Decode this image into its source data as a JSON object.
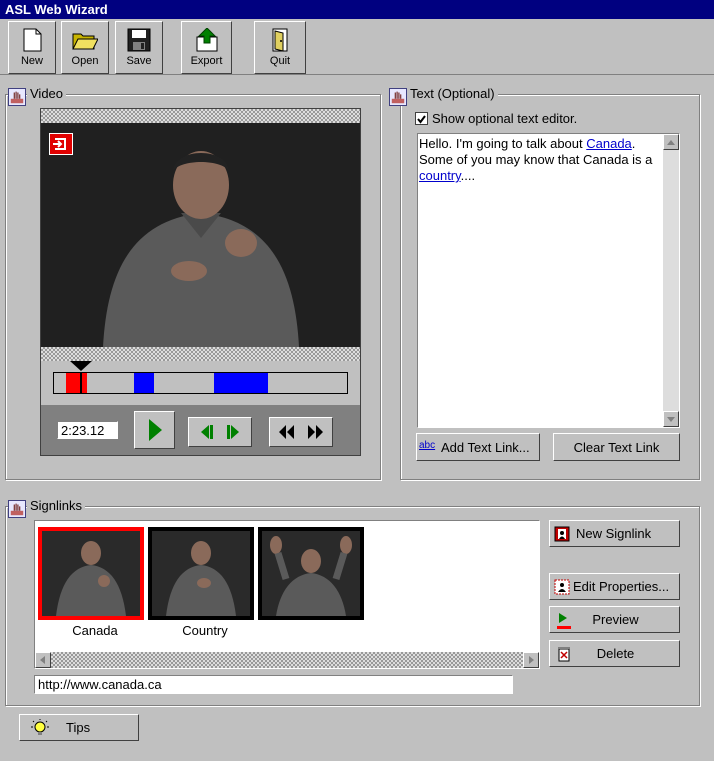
{
  "window": {
    "title": "ASL Web Wizard"
  },
  "toolbar": {
    "new_label": "New",
    "open_label": "Open",
    "save_label": "Save",
    "export_label": "Export",
    "quit_label": "Quit"
  },
  "video": {
    "group_label": "Video",
    "timecode": "2:23.12",
    "accent_color": "#ff0000",
    "marker_color": "#0000ff"
  },
  "text": {
    "group_label": "Text (Optional)",
    "checkbox_label": "Show optional text editor.",
    "checked": true,
    "body_part1": "Hello. I'm going to talk about ",
    "link1": "Canada",
    "body_part2": ". Some of you may know that Canada is a ",
    "link2": "country",
    "body_part3": "....",
    "add_link_label": "Add Text Link...",
    "add_link_icon_text": "abc",
    "clear_link_label": "Clear Text Link"
  },
  "signlinks": {
    "group_label": "Signlinks",
    "items": [
      {
        "label": "Canada",
        "selected": true
      },
      {
        "label": "Country",
        "selected": false
      },
      {
        "label": "",
        "selected": false
      }
    ],
    "url": "http://www.canada.ca",
    "new_label": "New Signlink",
    "edit_label": "Edit Properties...",
    "preview_label": "Preview",
    "delete_label": "Delete"
  },
  "tips": {
    "label": "Tips"
  }
}
